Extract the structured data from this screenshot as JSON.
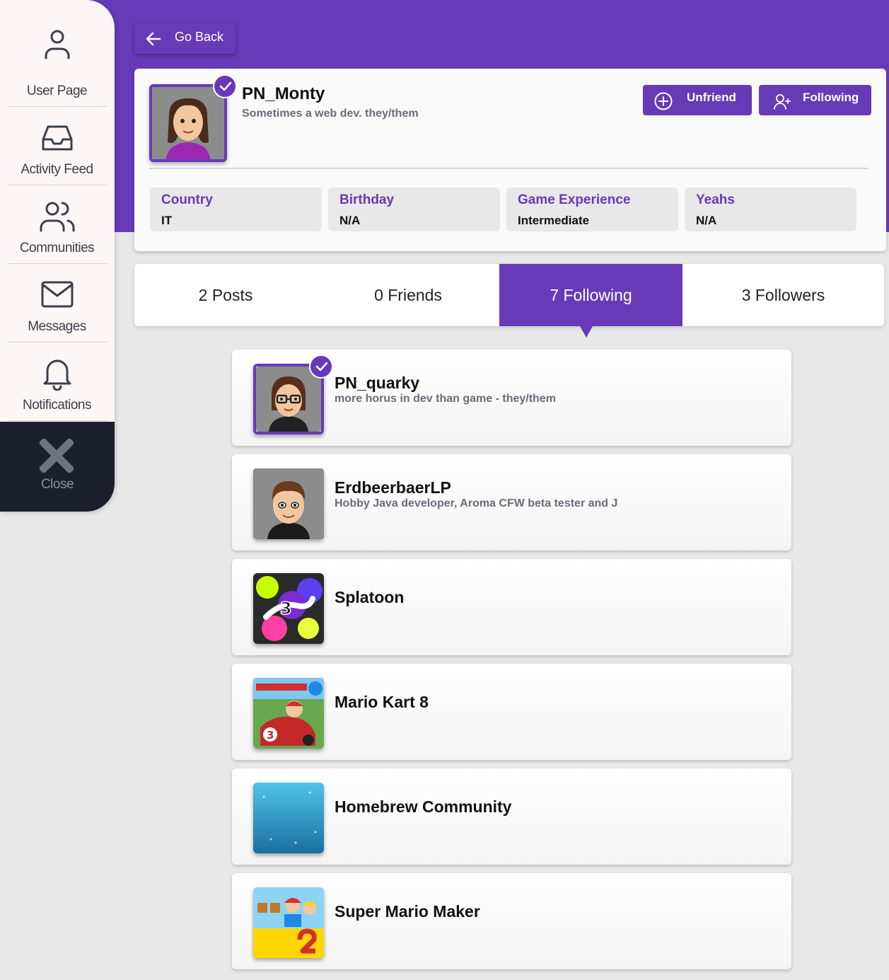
{
  "colors": {
    "accent": "#673ab7",
    "sidebar_bg": "#fdf6f6",
    "close_bg": "#1c1f2c"
  },
  "sidebar": {
    "items": [
      {
        "label": "User Page",
        "icon": "user-icon"
      },
      {
        "label": "Activity Feed",
        "icon": "inbox-icon"
      },
      {
        "label": "Communities",
        "icon": "users-icon"
      },
      {
        "label": "Messages",
        "icon": "mail-icon"
      },
      {
        "label": "Notifications",
        "icon": "bell-icon"
      }
    ],
    "close_label": "Close"
  },
  "header": {
    "go_back_label": "Go Back"
  },
  "profile": {
    "username": "PN_Monty",
    "bio": "Sometimes a web dev. they/them",
    "verified": true,
    "unfriend_label": "Unfriend",
    "following_label": "Following",
    "info": [
      {
        "key": "Country",
        "value": "IT"
      },
      {
        "key": "Birthday",
        "value": "N/A"
      },
      {
        "key": "Game Experience",
        "value": "Intermediate"
      },
      {
        "key": "Yeahs",
        "value": "N/A"
      }
    ]
  },
  "tabs": [
    {
      "label": "2 Posts",
      "active": false
    },
    {
      "label": "0 Friends",
      "active": false
    },
    {
      "label": "7 Following",
      "active": true
    },
    {
      "label": "3 Followers",
      "active": false
    }
  ],
  "following": [
    {
      "title": "PN_quarky",
      "subtitle": "more horus in dev than game - they/them",
      "verified": true,
      "type": "user"
    },
    {
      "title": "ErdbeerbaerLP",
      "subtitle": "Hobby Java developer, Aroma CFW beta tester and J",
      "verified": false,
      "type": "user"
    },
    {
      "title": "Splatoon",
      "subtitle": "",
      "type": "community"
    },
    {
      "title": "Mario Kart 8",
      "subtitle": "",
      "type": "community"
    },
    {
      "title": "Homebrew Community",
      "subtitle": "",
      "type": "community"
    },
    {
      "title": "Super Mario Maker",
      "subtitle": "",
      "type": "community"
    }
  ]
}
